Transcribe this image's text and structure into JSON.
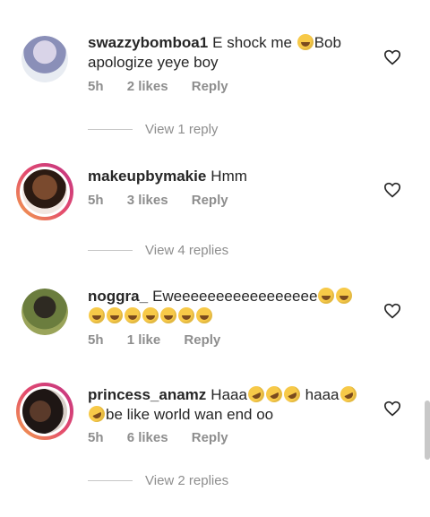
{
  "comments": [
    {
      "username": "swazzybomboa1",
      "text_a": "E shock me",
      "text_b": "Bob apologize yeye boy",
      "time": "5h",
      "likes": "2 likes",
      "reply": "Reply",
      "view_replies": "View 1 reply"
    },
    {
      "username": "makeupbymakie",
      "text_a": "Hmm",
      "time": "5h",
      "likes": "3 likes",
      "reply": "Reply",
      "view_replies": "View 4 replies"
    },
    {
      "username": "noggra_",
      "text_a": "Eweeeeeeeeeeeeeeeee",
      "time": "5h",
      "likes": "1 like",
      "reply": "Reply"
    },
    {
      "username": "princess_anamz",
      "text_a": "Haaa",
      "text_b": "haaa",
      "text_c": "be like world wan end oo",
      "time": "5h",
      "likes": "6 likes",
      "reply": "Reply",
      "view_replies": "View 2 replies"
    }
  ],
  "icons": {
    "like": "heart-outline-icon",
    "laugh": "face-with-tears-of-joy-emoji",
    "rofl": "rolling-on-floor-laughing-emoji"
  },
  "colors": {
    "text": "#262626",
    "muted": "#8e8e8e",
    "story_ring_start": "#f2a44b",
    "story_ring_end": "#c13584"
  }
}
